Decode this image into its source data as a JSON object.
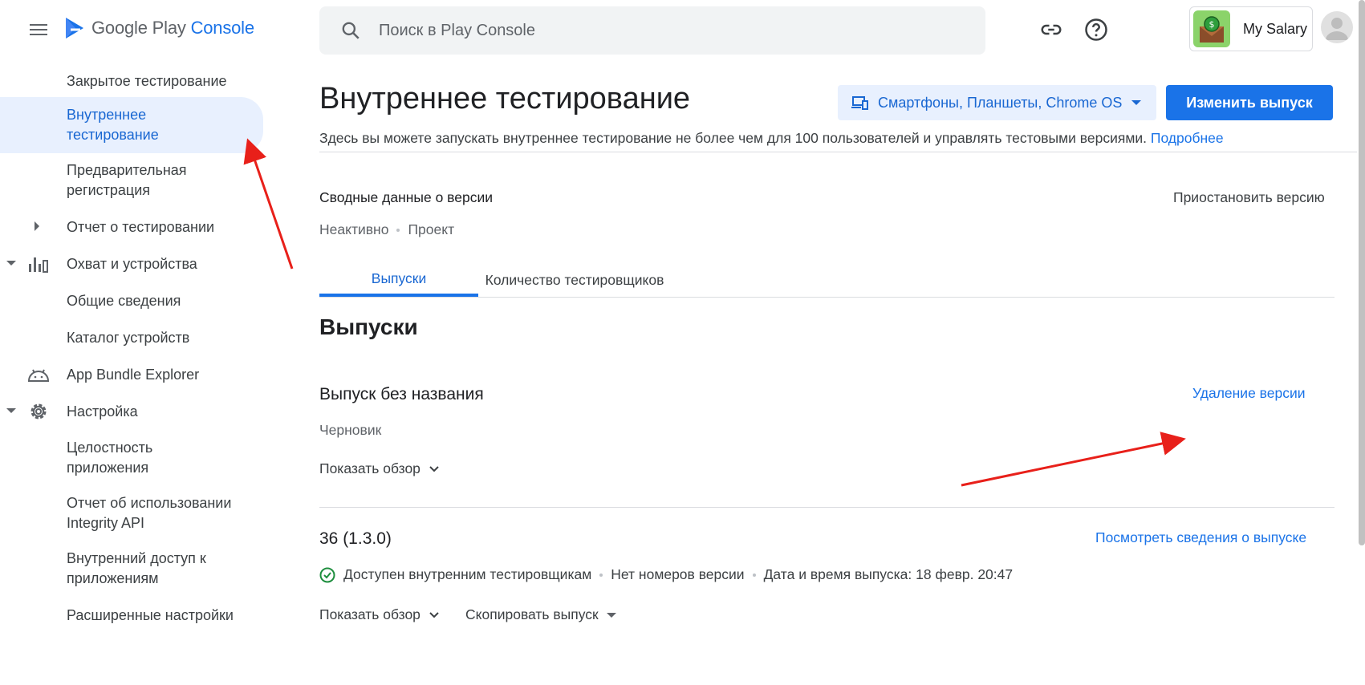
{
  "header": {
    "logo_prefix": "Google Play ",
    "logo_accent": "Console",
    "search_placeholder": "Поиск в Play Console",
    "app_name": "My Salary"
  },
  "icons": {
    "menu": "menu-icon",
    "logo": "play-console-logo",
    "search": "search-icon",
    "link": "link-icon",
    "help": "help-icon",
    "avatar": "account-avatar",
    "stats": "bar-chart-icon",
    "android": "android-icon",
    "settings": "gear-icon",
    "check": "check-circle-icon"
  },
  "sidebar": {
    "items": [
      {
        "label": "Закрытое тестирование"
      },
      {
        "label": "Внутреннее тестирование",
        "active": true
      },
      {
        "label": "Предварительная регистрация"
      },
      {
        "label": "Отчет о тестировании"
      },
      {
        "label": "Охват и устройства"
      },
      {
        "label": "Общие сведения"
      },
      {
        "label": "Каталог устройств"
      },
      {
        "label": "App Bundle Explorer"
      },
      {
        "label": "Настройка"
      },
      {
        "label": "Целостность приложения"
      },
      {
        "label": "Отчет об использовании Integrity API"
      },
      {
        "label": "Внутренний доступ к приложениям"
      },
      {
        "label": "Расширенные настройки"
      }
    ]
  },
  "main": {
    "title": "Внутреннее тестирование",
    "device_selector": "Смартфоны, Планшеты, Chrome OS",
    "edit_button": "Изменить выпуск",
    "description": "Здесь вы можете запускать внутреннее тестирование не более чем для 100 пользователей и управлять тестовыми версиями. ",
    "learn_more": "Подробнее",
    "summary_title": "Сводные данные о версии",
    "pause_link": "Приостановить версию",
    "status_inactive": "Неактивно",
    "status_project": "Проект",
    "tabs": [
      {
        "label": "Выпуски",
        "active": true
      },
      {
        "label": "Количество тестировщиков"
      }
    ],
    "section_title": "Выпуски",
    "releases": [
      {
        "name": "Выпуск без названия",
        "action": "Удаление версии",
        "status": "Черновик",
        "overview": "Показать обзор"
      },
      {
        "name": "36 (1.3.0)",
        "action": "Посмотреть сведения о выпуске",
        "availability": "Доступен внутренним тестировщикам",
        "version_numbers": "Нет номеров версии",
        "release_date": "Дата и время выпуска: 18 февр. 20:47",
        "overview": "Показать обзор",
        "copy": "Скопировать выпуск"
      }
    ]
  },
  "colors": {
    "accent": "#1a73e8",
    "active_bg": "#e8f0fe",
    "annotation_arrow": "#e8201a"
  }
}
